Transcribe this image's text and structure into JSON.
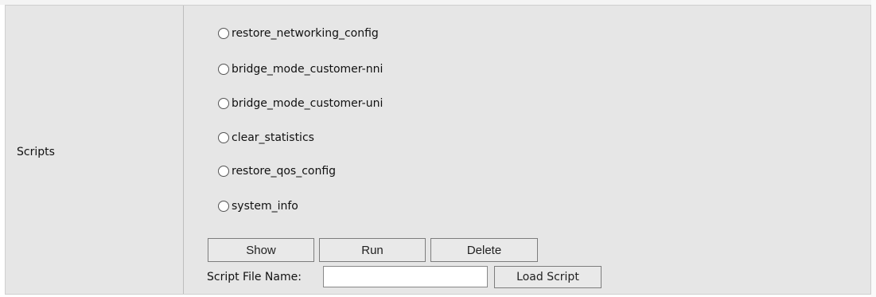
{
  "section": {
    "label": "Scripts"
  },
  "scripts": [
    {
      "name": "restore_networking_config",
      "selected": false
    },
    {
      "name": "bridge_mode_customer-nni",
      "selected": false
    },
    {
      "name": "bridge_mode_customer-uni",
      "selected": false
    },
    {
      "name": "clear_statistics",
      "selected": false
    },
    {
      "name": "restore_qos_config",
      "selected": false
    },
    {
      "name": "system_info",
      "selected": false
    }
  ],
  "buttons": {
    "show": "Show",
    "run": "Run",
    "delete": "Delete"
  },
  "file": {
    "label": "Script File Name:",
    "value": "",
    "load_label": "Load Script"
  }
}
